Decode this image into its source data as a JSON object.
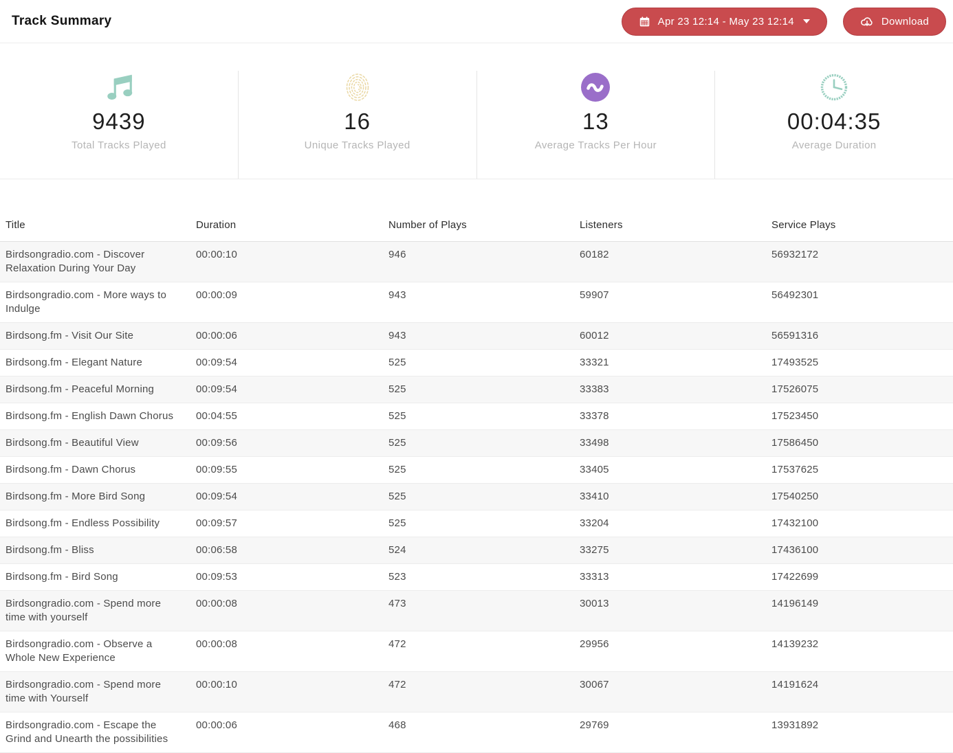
{
  "header": {
    "title": "Track Summary",
    "date_range_button": {
      "label": "Apr 23 12:14 - May 23 12:14",
      "icon": "calendar-icon"
    },
    "download_button": {
      "label": "Download",
      "icon": "cloud-download-icon"
    }
  },
  "stats": [
    {
      "icon": "music-note-icon",
      "value": "9439",
      "label": "Total Tracks Played",
      "color": "#99cfc0"
    },
    {
      "icon": "fingerprint-icon",
      "value": "16",
      "label": "Unique Tracks Played",
      "color": "#ead8a4"
    },
    {
      "icon": "wave-icon",
      "value": "13",
      "label": "Average Tracks Per Hour",
      "color": "#9a6ec9"
    },
    {
      "icon": "clock-icon",
      "value": "00:04:35",
      "label": "Average Duration",
      "color": "#99cfc0"
    }
  ],
  "table": {
    "columns": [
      "Title",
      "Duration",
      "Number of Plays",
      "Listeners",
      "Service Plays"
    ],
    "rows": [
      [
        "Birdsongradio.com - Discover Relaxation During Your Day",
        "00:00:10",
        "946",
        "60182",
        "56932172"
      ],
      [
        "Birdsongradio.com - More ways to Indulge",
        "00:00:09",
        "943",
        "59907",
        "56492301"
      ],
      [
        "Birdsong.fm - Visit Our Site",
        "00:00:06",
        "943",
        "60012",
        "56591316"
      ],
      [
        "Birdsong.fm - Elegant Nature",
        "00:09:54",
        "525",
        "33321",
        "17493525"
      ],
      [
        "Birdsong.fm - Peaceful Morning",
        "00:09:54",
        "525",
        "33383",
        "17526075"
      ],
      [
        "Birdsong.fm - English Dawn Chorus",
        "00:04:55",
        "525",
        "33378",
        "17523450"
      ],
      [
        "Birdsong.fm - Beautiful View",
        "00:09:56",
        "525",
        "33498",
        "17586450"
      ],
      [
        "Birdsong.fm - Dawn Chorus",
        "00:09:55",
        "525",
        "33405",
        "17537625"
      ],
      [
        "Birdsong.fm - More Bird Song",
        "00:09:54",
        "525",
        "33410",
        "17540250"
      ],
      [
        "Birdsong.fm - Endless Possibility",
        "00:09:57",
        "525",
        "33204",
        "17432100"
      ],
      [
        "Birdsong.fm - Bliss",
        "00:06:58",
        "524",
        "33275",
        "17436100"
      ],
      [
        "Birdsong.fm - Bird Song",
        "00:09:53",
        "523",
        "33313",
        "17422699"
      ],
      [
        "Birdsongradio.com - Spend more time with yourself",
        "00:00:08",
        "473",
        "30013",
        "14196149"
      ],
      [
        "Birdsongradio.com - Observe a Whole New Experience",
        "00:00:08",
        "472",
        "29956",
        "14139232"
      ],
      [
        "Birdsongradio.com - Spend more time with Yourself",
        "00:00:10",
        "472",
        "30067",
        "14191624"
      ],
      [
        "Birdsongradio.com - Escape the Grind and Unearth the possibilities",
        "00:00:06",
        "468",
        "29769",
        "13931892"
      ]
    ]
  },
  "colors": {
    "accent_red": "#c94b4e",
    "teal": "#99cfc0",
    "tan": "#ead8a4",
    "purple": "#9a6ec9",
    "row_alt": "#f7f7f7"
  }
}
